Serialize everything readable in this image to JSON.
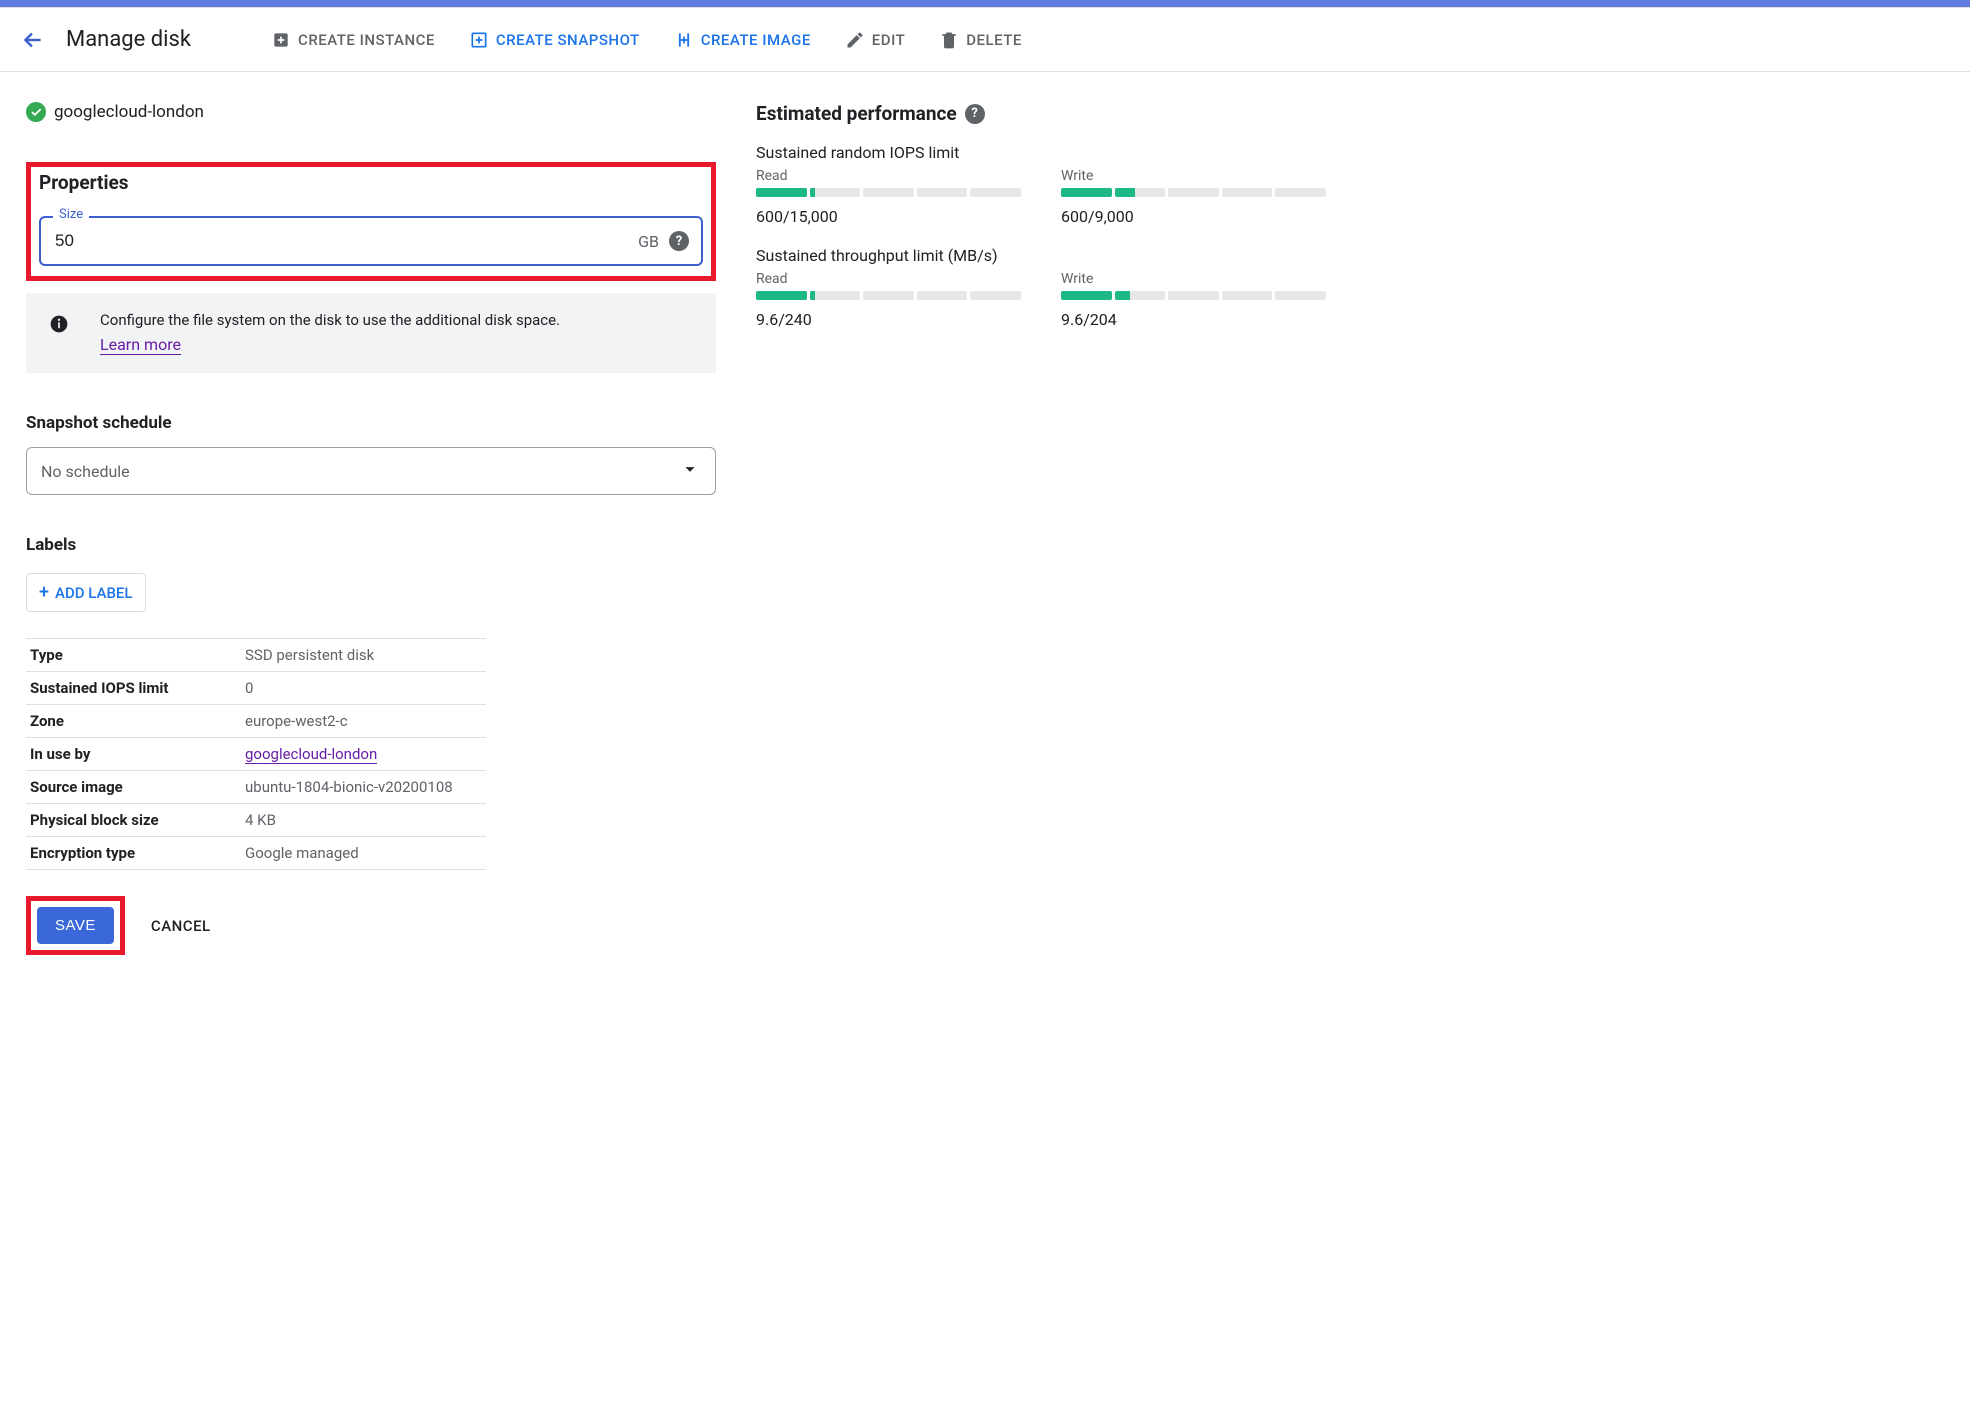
{
  "header": {
    "title": "Manage disk",
    "actions": {
      "create_instance": "CREATE INSTANCE",
      "create_snapshot": "CREATE SNAPSHOT",
      "create_image": "CREATE IMAGE",
      "edit": "EDIT",
      "delete": "DELETE"
    }
  },
  "resource": {
    "name": "googlecloud-london"
  },
  "properties": {
    "heading": "Properties",
    "size_label": "Size",
    "size_value": "50",
    "size_unit": "GB",
    "info_text": "Configure the file system on the disk to use the additional disk space.",
    "info_link": "Learn more"
  },
  "snapshot": {
    "heading": "Snapshot schedule",
    "value": "No schedule"
  },
  "labels": {
    "heading": "Labels",
    "add_button": "ADD LABEL"
  },
  "details": {
    "rows": [
      {
        "key": "Type",
        "val": "SSD persistent disk"
      },
      {
        "key": "Sustained IOPS limit",
        "val": "0"
      },
      {
        "key": "Zone",
        "val": "europe-west2-c"
      },
      {
        "key": "In use by",
        "val": "googlecloud-london",
        "link": true
      },
      {
        "key": "Source image",
        "val": "ubuntu-1804-bionic-v20200108"
      },
      {
        "key": "Physical block size",
        "val": "4 KB"
      },
      {
        "key": "Encryption type",
        "val": "Google managed"
      }
    ]
  },
  "footer": {
    "save": "SAVE",
    "cancel": "CANCEL"
  },
  "performance": {
    "heading": "Estimated performance",
    "iops": {
      "title": "Sustained random IOPS limit",
      "read": {
        "label": "Read",
        "value": "600/15,000",
        "fillpct": 22
      },
      "write": {
        "label": "Write",
        "value": "600/9,000",
        "fillpct": 28
      }
    },
    "throughput": {
      "title": "Sustained throughput limit (MB/s)",
      "read": {
        "label": "Read",
        "value": "9.6/240",
        "fillpct": 22
      },
      "write": {
        "label": "Write",
        "value": "9.6/204",
        "fillpct": 26
      }
    }
  }
}
